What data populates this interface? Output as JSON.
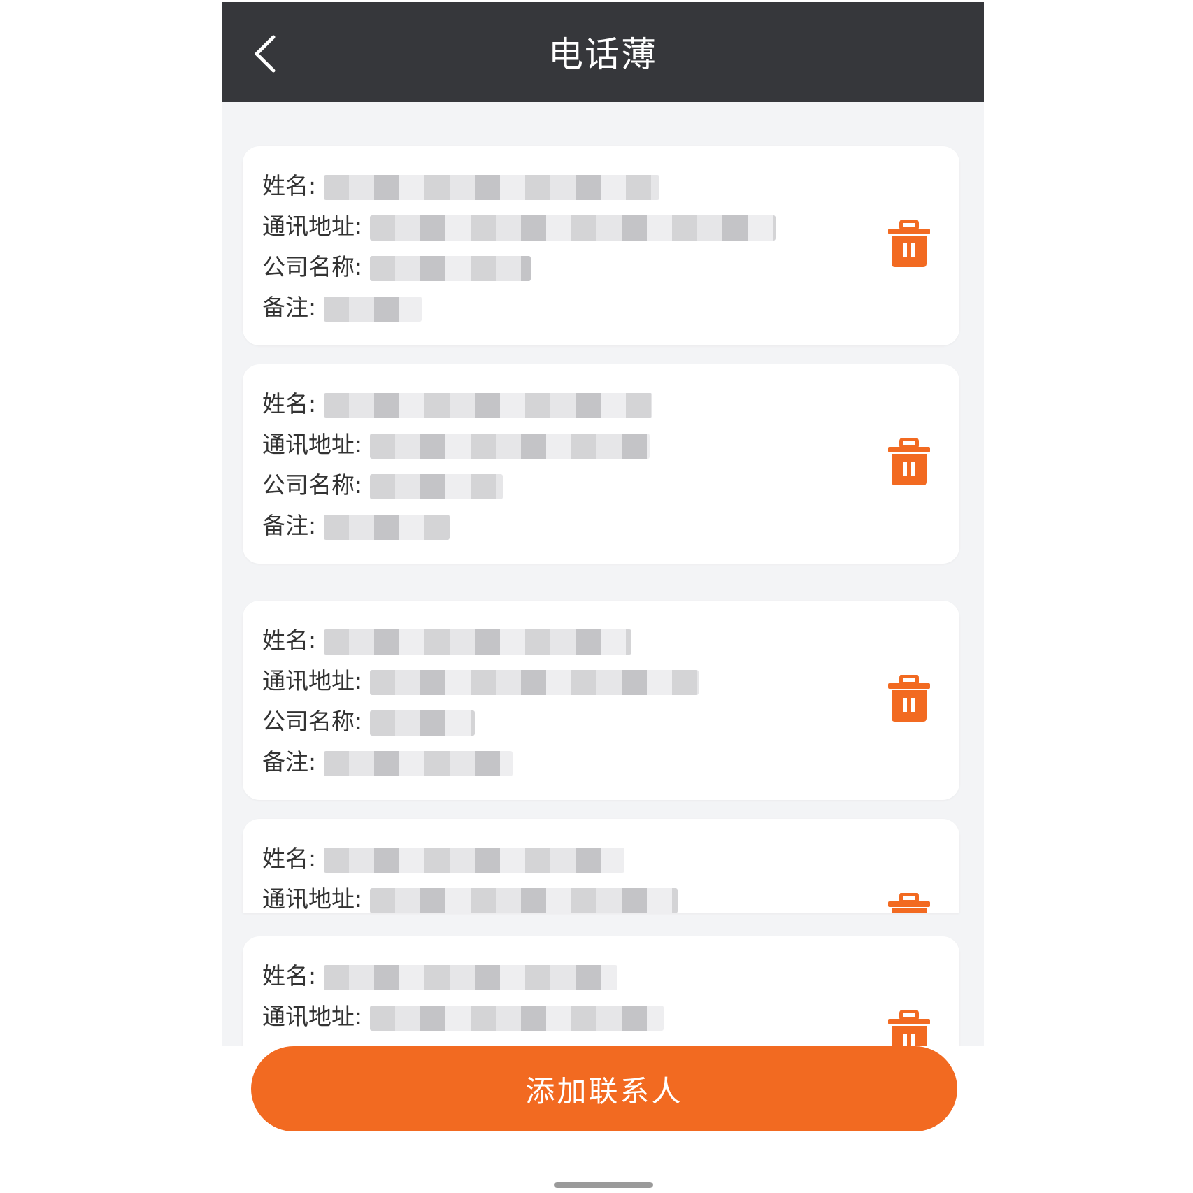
{
  "header": {
    "title": "电话薄"
  },
  "labels": {
    "name": "姓名:",
    "address": "通讯地址:",
    "company": "公司名称:",
    "remark": "备注:"
  },
  "colors": {
    "accent": "#f26a21",
    "header_bg": "#36373b",
    "page_bg": "#f3f4f6"
  },
  "contacts": [
    {
      "name": "",
      "address": "",
      "company": "",
      "remark": ""
    },
    {
      "name": "",
      "address": "",
      "company": "",
      "remark": ""
    },
    {
      "name": "",
      "address": "",
      "company": "",
      "remark": ""
    },
    {
      "name": "",
      "address": "",
      "company": "",
      "remark": ""
    },
    {
      "name": "",
      "address": "",
      "company": "",
      "remark": ""
    }
  ],
  "icons": {
    "back": "chevron-left-icon",
    "delete": "trash-icon"
  },
  "footer": {
    "add_label": "添加联系人"
  }
}
